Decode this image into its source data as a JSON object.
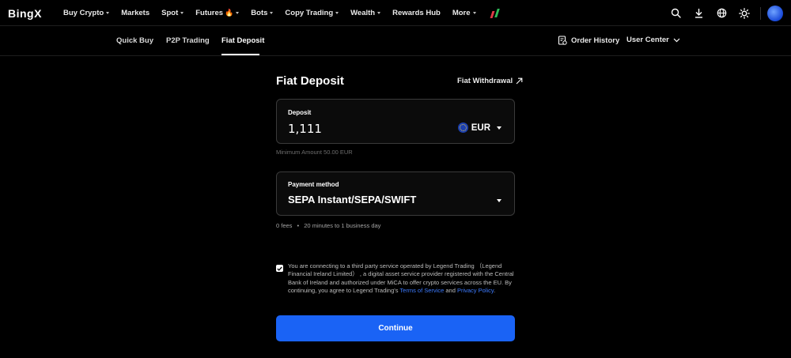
{
  "brand": {
    "logo_text": "BingX",
    "accent": "#1a63f5",
    "link": "#3d7bff"
  },
  "nav": [
    {
      "label": "Buy Crypto",
      "caret": true
    },
    {
      "label": "Markets",
      "caret": false
    },
    {
      "label": "Spot",
      "caret": true
    },
    {
      "label": "Futures",
      "caret": true,
      "badge": "fire-icon"
    },
    {
      "label": "Bots",
      "caret": true
    },
    {
      "label": "Copy Trading",
      "caret": true
    },
    {
      "label": "Wealth",
      "caret": true
    },
    {
      "label": "Rewards Hub",
      "caret": false
    },
    {
      "label": "More",
      "caret": true
    }
  ],
  "top_icons": [
    "search-icon",
    "download-icon",
    "globe-icon",
    "theme-icon",
    "avatar"
  ],
  "subnav": {
    "tabs": [
      {
        "label": "Quick Buy",
        "active": false
      },
      {
        "label": "P2P Trading",
        "active": false
      },
      {
        "label": "Fiat Deposit",
        "active": true
      }
    ],
    "order_history": "Order History",
    "user_center": "User Center"
  },
  "main": {
    "title": "Fiat Deposit",
    "withdraw_link": "Fiat Withdrawal",
    "deposit": {
      "label": "Deposit",
      "amount": "1,111",
      "currency": "EUR",
      "min_amount": "Minimum Amount 50.00 EUR"
    },
    "payment": {
      "label": "Payment method",
      "value": "SEPA Instant/SEPA/SWIFT",
      "fees": "0 fees",
      "sep": "•",
      "time": "20 minutes to 1 business day"
    },
    "consent": {
      "checked": true,
      "text_before": "You are connecting to a third party service operated by Legend Trading （Legend Financial Ireland Limited） , a digital asset service provider registered with the Central Bank of Ireland and authorized under MiCA to offer crypto services across the EU. By continuing, you agree to Legend Trading's ",
      "terms": "Terms of Service",
      "and": " and ",
      "privacy": "Privacy Policy",
      "end": "."
    },
    "continue_label": "Continue"
  }
}
